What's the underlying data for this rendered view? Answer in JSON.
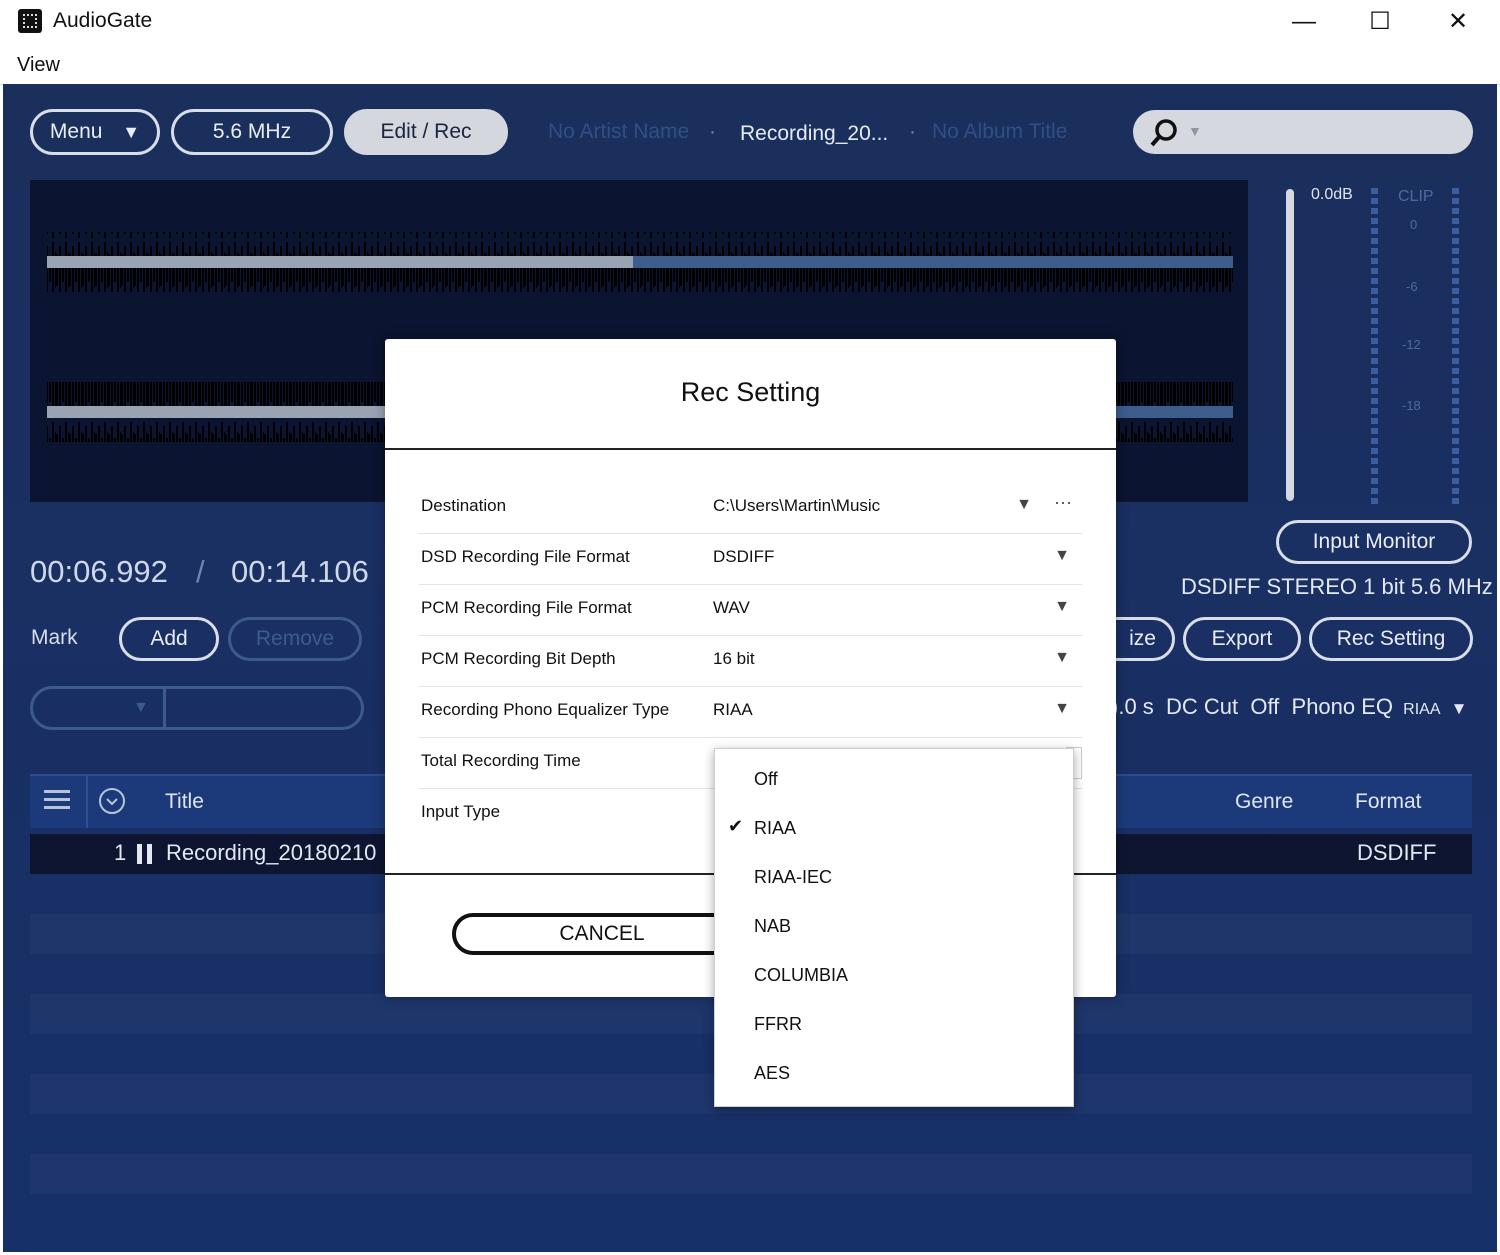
{
  "window": {
    "title": "AudioGate",
    "minimize_glyph": "—",
    "maximize_glyph": "☐",
    "close_glyph": "✕"
  },
  "menubar": {
    "view": "View"
  },
  "toolbar": {
    "menu_label": "Menu",
    "menu_arrow": "▼",
    "rate_label": "5.6 MHz",
    "edit_rec_label": "Edit / Rec",
    "artist": "No Artist Name",
    "sep1": "·",
    "track": "Recording_20...",
    "sep2": "·",
    "album": "No Album Title",
    "search_arrow": "▼"
  },
  "meter": {
    "db": "0.0dB",
    "clip": "CLIP",
    "t0": "0",
    "t6": "-6",
    "t12": "-12",
    "t18": "-18"
  },
  "transport": {
    "current": "00:06.992",
    "slash": "/",
    "total": "00:14.106"
  },
  "mark": {
    "label": "Mark",
    "add": "Add",
    "remove": "Remove",
    "combo_arrow": "▼"
  },
  "right_panel": {
    "input_monitor": "Input Monitor",
    "format_info": "DSDIFF STEREO 1 bit 5.6 MHz",
    "partial_button": "ize",
    "export": "Export",
    "rec_setting": "Rec Setting",
    "status": ").0 s  DC Cut  Off  Phono EQ",
    "status_eq": "RIAA",
    "status_arrow": "▼"
  },
  "table": {
    "col_title": "Title",
    "col_genre": "Genre",
    "col_format": "Format",
    "rows": [
      {
        "num": "1",
        "title": "Recording_20180210",
        "format": "DSDIFF"
      }
    ]
  },
  "dialog": {
    "title": "Rec Setting",
    "rows": [
      {
        "label": "Destination",
        "value": "C:\\Users\\Martin\\Music",
        "arrow": "▼",
        "more": "···"
      },
      {
        "label": "DSD Recording File Format",
        "value": "DSDIFF",
        "arrow": "▼"
      },
      {
        "label": "PCM Recording File Format",
        "value": "WAV",
        "arrow": "▼"
      },
      {
        "label": "PCM Recording Bit Depth",
        "value": "16 bit",
        "arrow": "▼"
      },
      {
        "label": "Recording Phono Equalizer Type",
        "value": "RIAA",
        "arrow": "▼"
      },
      {
        "label": "Total Recording Time",
        "value": "",
        "arrow": ""
      },
      {
        "label": "Input Type",
        "value": "",
        "arrow": ""
      }
    ],
    "cancel": "CANCEL"
  },
  "eq_dropdown": {
    "options": [
      "Off",
      "RIAA",
      "RIAA-IEC",
      "NAB",
      "COLUMBIA",
      "FFRR",
      "AES"
    ],
    "selected": "RIAA",
    "check": "✔"
  },
  "colors": {
    "app_bg": "#1a2f62",
    "wave_played": "#9aa3b2",
    "wave_unplayed": "#3d5d8c",
    "accent": "#d8dde8"
  }
}
